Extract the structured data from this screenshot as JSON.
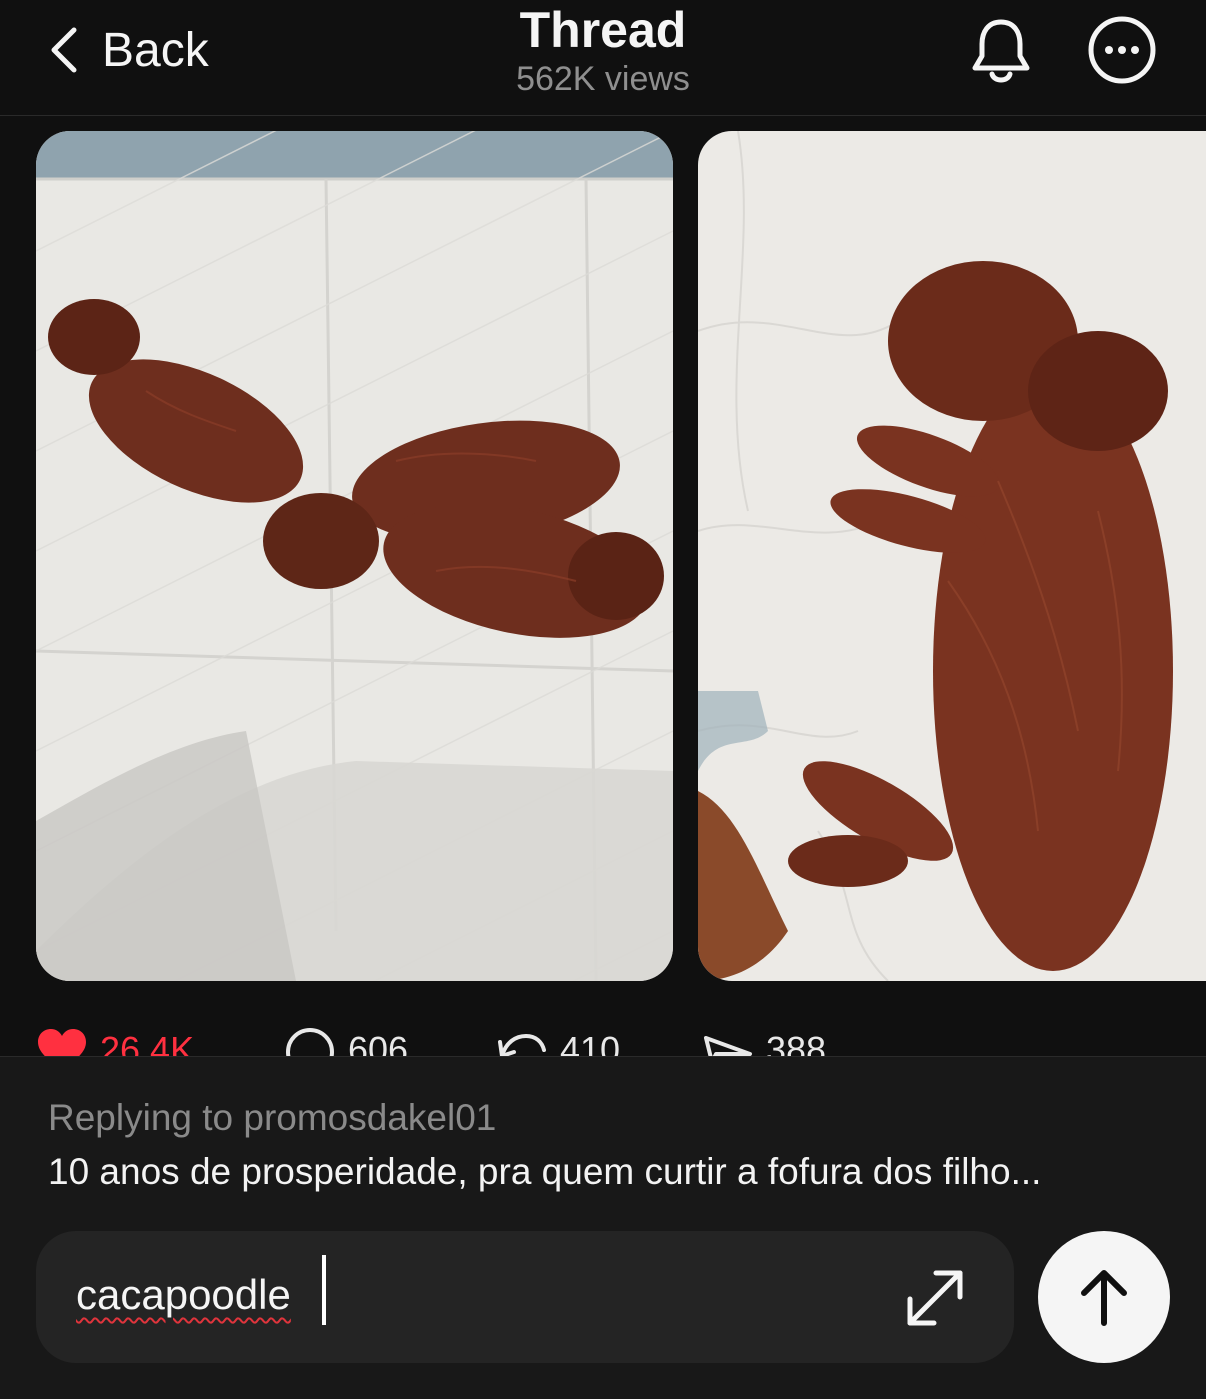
{
  "header": {
    "back_label": "Back",
    "title": "Thread",
    "views": "562K views"
  },
  "post": {
    "media": [
      {
        "icon": "photo-three-puppies-on-pad"
      },
      {
        "icon": "photo-sleeping-puppy-on-pad"
      }
    ],
    "stats": {
      "likes": "26.4K",
      "comments": "606",
      "reposts": "410",
      "shares": "388"
    },
    "like_color": "#ff3040"
  },
  "reply": {
    "replying_to": "Replying to promosdakel01",
    "original_text": "10 anos de prosperidade, pra quem curtir a fofura dos filho...",
    "draft": "cacapoodle"
  },
  "colors": {
    "background": "#101010",
    "reply_panel": "#181818",
    "input_bg": "#242424",
    "send_button": "#f5f5f5"
  }
}
